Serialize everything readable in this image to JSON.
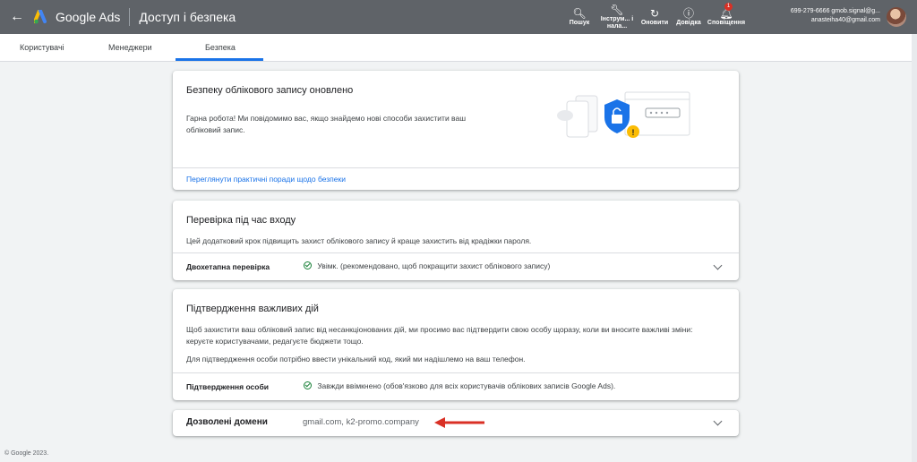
{
  "header": {
    "brand": "Google Ads",
    "page_title": "Доступ і безпека",
    "tools": [
      {
        "icon": "search-icon",
        "label": "Пошук"
      },
      {
        "icon": "wrench-icon",
        "label": "Інструм... і нала..."
      },
      {
        "icon": "refresh-icon",
        "label": "Оновити"
      },
      {
        "icon": "help-icon",
        "label": "Довідка"
      },
      {
        "icon": "bell-icon",
        "label": "Сповіщення",
        "badge": "1"
      }
    ],
    "account_line1": "699-279-6666 gmob.signal@g...",
    "account_line2": "anasteiha40@gmail.com"
  },
  "tabs": [
    "Користувачі",
    "Менеджери",
    "Безпека"
  ],
  "card1": {
    "title": "Безпеку облікового запису оновлено",
    "text": "Гарна робота! Ми повідомимо вас, якщо знайдемо нові способи захистити ваш обліковий запис.",
    "link": "Переглянути практичні поради щодо безпеки"
  },
  "card2": {
    "title": "Перевірка під час входу",
    "text": "Цей додатковий крок підвищить захист облікового запису й краще захистить від крадіжки пароля.",
    "row_label": "Двохетапна перевірка",
    "row_value": "Увімк. (рекомендовано, щоб покращити захист облікового запису)"
  },
  "card3": {
    "title": "Підтвердження важливих дій",
    "text1": "Щоб захистити ваш обліковий запис від несанкціонованих дій, ми просимо вас підтвердити свою особу щоразу, коли ви вносите важливі зміни: керуєте користувачами, редагуєте бюджети тощо.",
    "text2": "Для підтвердження особи потрібно ввести унікальний код, який ми надішлемо на ваш телефон.",
    "row_label": "Підтвердження особи",
    "row_value": "Завжди ввімкнено (обов'язково для всіх користувачів облікових записів Google Ads)."
  },
  "card4": {
    "title": "Дозволені домени",
    "value": "gmail.com, k2-promo.company"
  },
  "footer": "© Google 2023.",
  "colors": {
    "accent": "#1a73e8",
    "topbar": "#5f6368",
    "arrow": "#d93025",
    "success": "#188038"
  }
}
